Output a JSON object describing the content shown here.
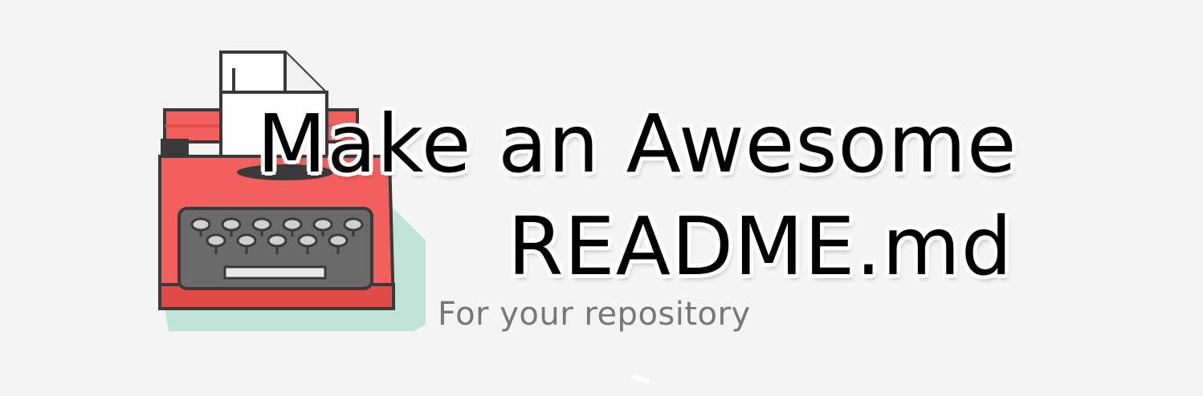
{
  "banner": {
    "title_line_1": "Make an Awesome",
    "title_line_2": "README.md",
    "subtitle": "For your repository"
  },
  "colors": {
    "background": "#f4f4f4",
    "typewriter_body": "#f25f5c",
    "typewriter_dark": "#e04a47",
    "keyboard": "#6a6a6a",
    "keys": "#cfcfcf",
    "shadow": "#bfe3d6",
    "paper": "#ffffff",
    "title_text": "#000000",
    "subtitle_text": "#777777"
  },
  "icons": {
    "logo": "typewriter-icon"
  }
}
